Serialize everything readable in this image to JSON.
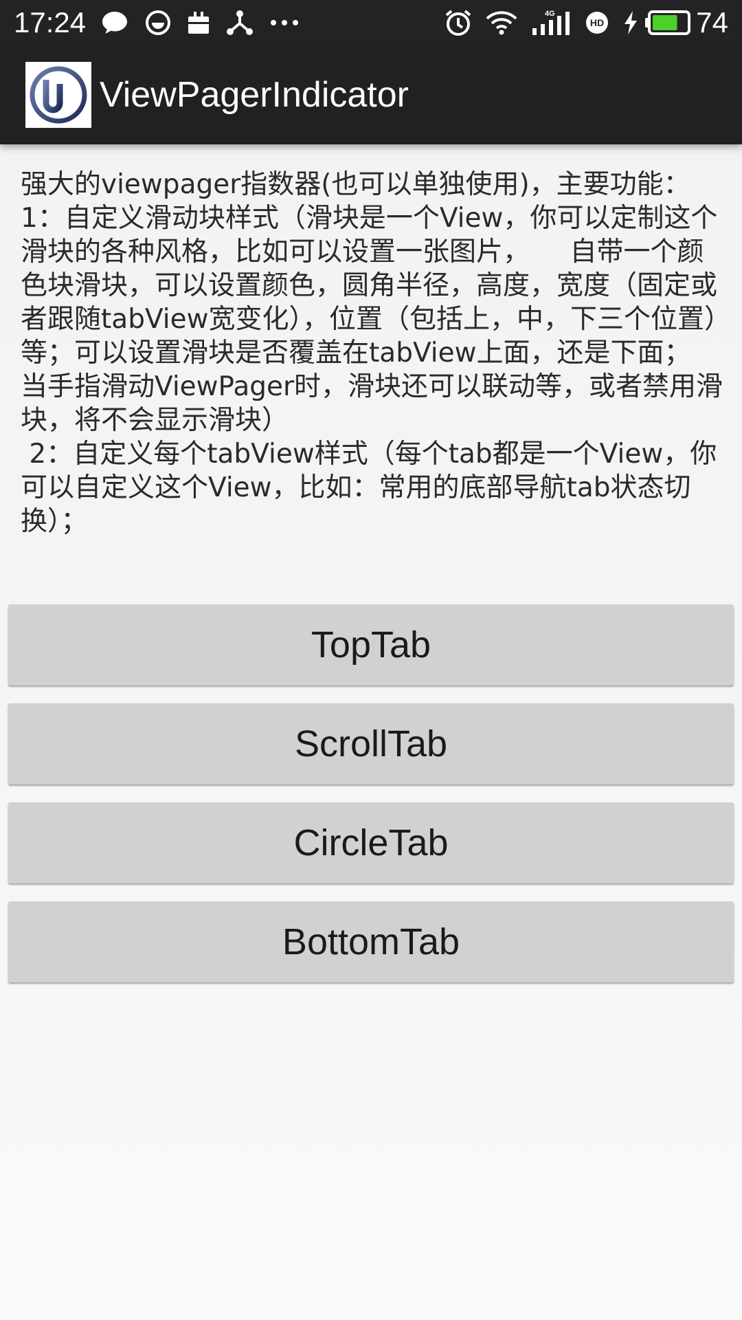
{
  "status_bar": {
    "time": "17:24",
    "left_icons": [
      "chat-bubble-icon",
      "smile-face-icon",
      "briefcase-icon",
      "share-network-icon",
      "more-dots-icon"
    ],
    "right_icons": [
      "alarm-clock-icon",
      "wifi-icon",
      "signal-4g-icon",
      "hd-icon",
      "charging-bolt-icon",
      "battery-icon"
    ],
    "network_label": "4G",
    "hd_label": "HD",
    "battery_percent": "74",
    "battery_level": 0.74,
    "battery_color": "#4cd12c"
  },
  "action_bar": {
    "title": "ViewPagerIndicator",
    "logo_icon": "app-logo-icon",
    "background": "#212121"
  },
  "description": "强大的viewpager指数器(也可以单独使用)，主要功能：1：自定义滑动块样式（滑块是一个View，你可以定制这个滑块的各种风格，比如可以设置一张图片，　　自带一个颜色块滑块，可以设置颜色，圆角半径，高度，宽度（固定或者跟随tabView宽变化），位置（包括上，中，下三个位置）等；可以设置滑块是否覆盖在tabView上面，还是下面；　　当手指滑动ViewPager时，滑块还可以联动等，或者禁用滑块，将不会显示滑块）\n 2：自定义每个tabView样式（每个tab都是一个View，你可以自定义这个View，比如：常用的底部导航tab状态切换）；",
  "buttons": [
    {
      "label": "TopTab"
    },
    {
      "label": "ScrollTab"
    },
    {
      "label": "CircleTab"
    },
    {
      "label": "BottomTab"
    }
  ]
}
